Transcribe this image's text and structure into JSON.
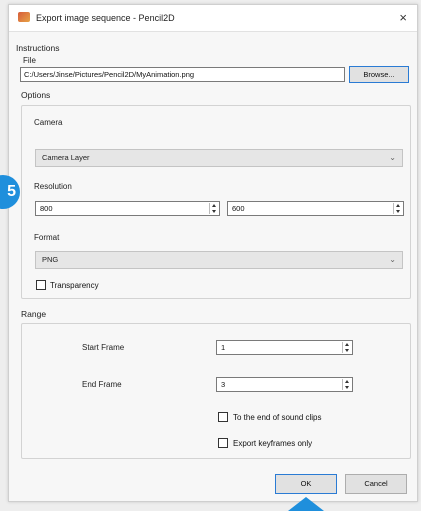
{
  "window": {
    "title": "Export image sequence - Pencil2D",
    "close_glyph": "×"
  },
  "instructions": {
    "label": "Instructions"
  },
  "file": {
    "label": "File",
    "value": "C:/Users/Jinse/Pictures/Pencil2D/MyAnimation.png",
    "browse_label": "Browse..."
  },
  "options": {
    "label": "Options",
    "camera": {
      "label": "Camera",
      "selected": "Camera Layer"
    },
    "resolution": {
      "label": "Resolution",
      "width": "800",
      "height": "600"
    },
    "format": {
      "label": "Format",
      "selected": "PNG"
    },
    "transparency": {
      "label": "Transparency",
      "checked": false
    }
  },
  "range": {
    "label": "Range",
    "start_frame": {
      "label": "Start Frame",
      "value": "1"
    },
    "end_frame": {
      "label": "End Frame",
      "value": "3"
    },
    "to_end_sound": {
      "label": "To the end of sound clips",
      "checked": false
    },
    "export_keyframes": {
      "label": "Export keyframes only",
      "checked": false
    }
  },
  "buttons": {
    "ok": "OK",
    "cancel": "Cancel"
  },
  "step_badge": {
    "text": "5"
  },
  "colors": {
    "accent": "#1f8fdc",
    "default_button_border": "#2a7bd4"
  }
}
